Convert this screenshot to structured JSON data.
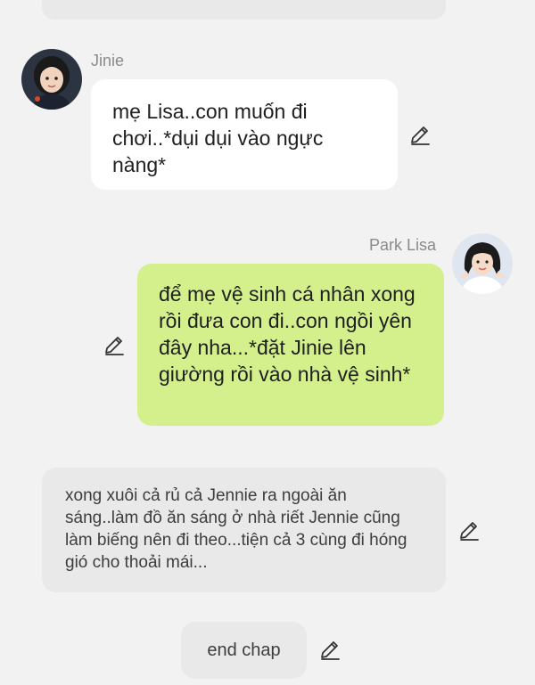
{
  "messages": [
    {
      "sender": "Jinie",
      "text": "mẹ Lisa..con muốn đi chơi..*dụi dụi vào ngực nàng*"
    },
    {
      "sender": "Park Lisa",
      "text": "để mẹ vệ sinh cá nhân xong rồi đưa con đi..con ngồi yên đây nha...*đặt Jinie lên giường rồi vào nhà vệ sinh*"
    }
  ],
  "narration": "xong xuôi cả rủ cả Jennie ra ngoài ăn sáng..làm đồ ăn sáng ở nhà riết Jennie cũng làm biếng nên đi theo...tiện cả 3 cùng đi hóng gió cho thoải mái...",
  "end_label": "end chap",
  "icons": {
    "edit": "pencil-edit-icon",
    "avatar_left": "avatar-jinie",
    "avatar_right": "avatar-park-lisa"
  },
  "colors": {
    "background": "#f2f2f2",
    "incoming_bubble": "#ffffff",
    "outgoing_bubble": "#d4f08d",
    "narration_bubble": "#e9e9e9",
    "name_text": "#8a8a8a"
  }
}
